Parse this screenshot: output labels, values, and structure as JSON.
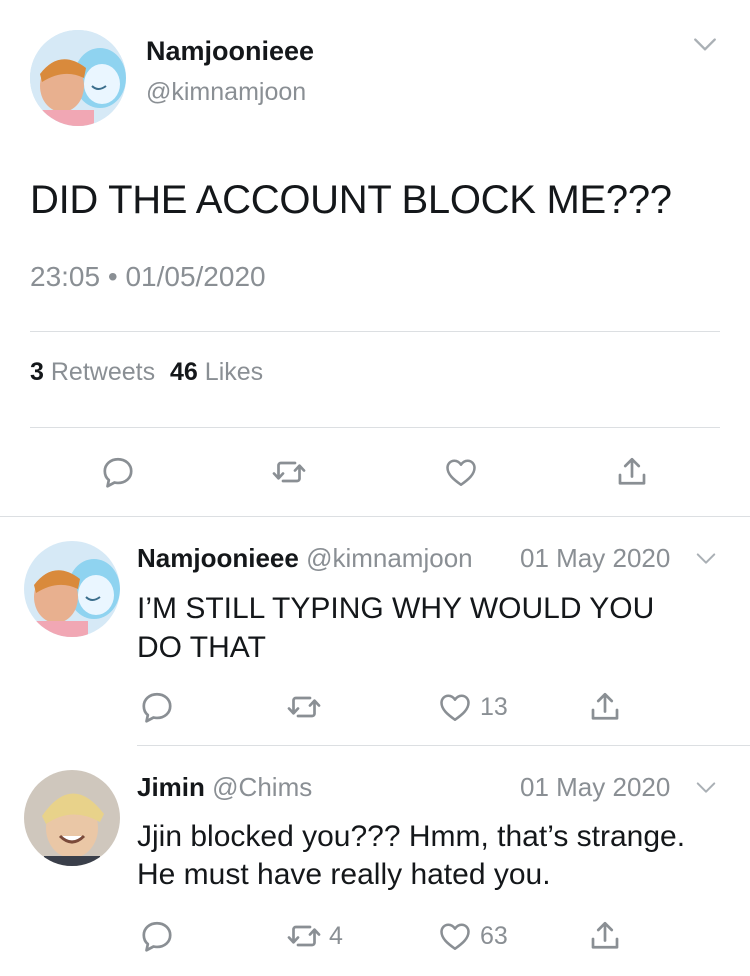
{
  "main_tweet": {
    "display_name": "Namjoonieee",
    "handle": "@kimnamjoon",
    "text": "DID THE ACCOUNT BLOCK ME???",
    "time": "23:05",
    "separator": "•",
    "date": "01/05/2020",
    "stats": {
      "retweets_count": "3",
      "retweets_label": "Retweets",
      "likes_count": "46",
      "likes_label": "Likes"
    }
  },
  "replies": [
    {
      "display_name": "Namjoonieee",
      "handle": "@kimnamjoon",
      "date": "01 May 2020",
      "text": "I’M STILL TYPING WHY WOULD YOU DO THAT",
      "retweets": "",
      "likes": "13"
    },
    {
      "display_name": "Jimin",
      "handle": "@Chims",
      "date": "01 May 2020",
      "text": "Jjin blocked you??? Hmm, that’s strange. He must have really hated you.",
      "retweets": "4",
      "likes": "63"
    }
  ],
  "icons": [
    "chevron-down-icon",
    "reply-icon",
    "retweet-icon",
    "like-icon",
    "share-icon"
  ],
  "colors": {
    "text": "#14171a",
    "muted": "#8a8f94",
    "divider": "#dcdfe2",
    "icon": "#8a8f94"
  }
}
